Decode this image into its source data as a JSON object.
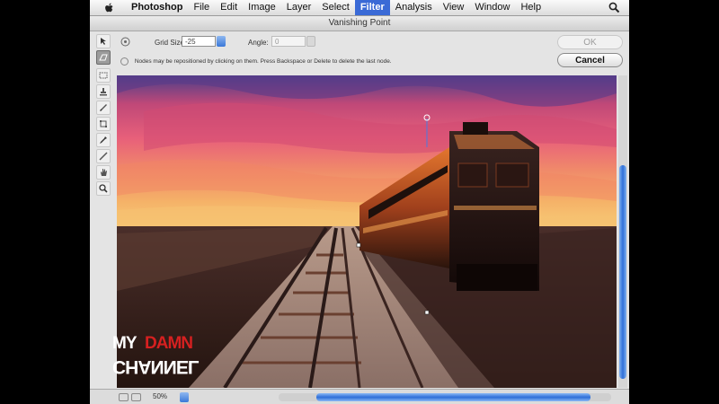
{
  "menubar": {
    "items": [
      {
        "label": "Photoshop"
      },
      {
        "label": "File"
      },
      {
        "label": "Edit"
      },
      {
        "label": "Image"
      },
      {
        "label": "Layer"
      },
      {
        "label": "Select"
      },
      {
        "label": "Filter"
      },
      {
        "label": "Analysis"
      },
      {
        "label": "View"
      },
      {
        "label": "Window"
      },
      {
        "label": "Help"
      }
    ],
    "active": "Filter",
    "icons": [
      "apple-icon",
      "spotlight-search-icon"
    ]
  },
  "dialog": {
    "title": "Vanishing Point",
    "options": {
      "grid_size_label": "Grid Size:",
      "grid_size_value": "-25",
      "angle_label": "Angle:",
      "angle_value": "0"
    },
    "hint": "Nodes may be repositioned by clicking on them. Press Backspace or Delete to delete the last node.",
    "ok_label": "OK",
    "cancel_label": "Cancel",
    "tools": [
      "edit-plane-tool",
      "create-plane-tool",
      "marquee-tool",
      "stamp-tool",
      "brush-tool",
      "transform-tool",
      "eyedropper-tool",
      "measure-tool",
      "hand-tool",
      "zoom-tool"
    ],
    "zoom_value": "50%"
  },
  "watermark": {
    "line1a": "MY",
    "line1b": "DAMN",
    "line2": "CHANNEL"
  },
  "colors": {
    "accent": "#3a6ad6",
    "watermark_red": "#d62020"
  }
}
